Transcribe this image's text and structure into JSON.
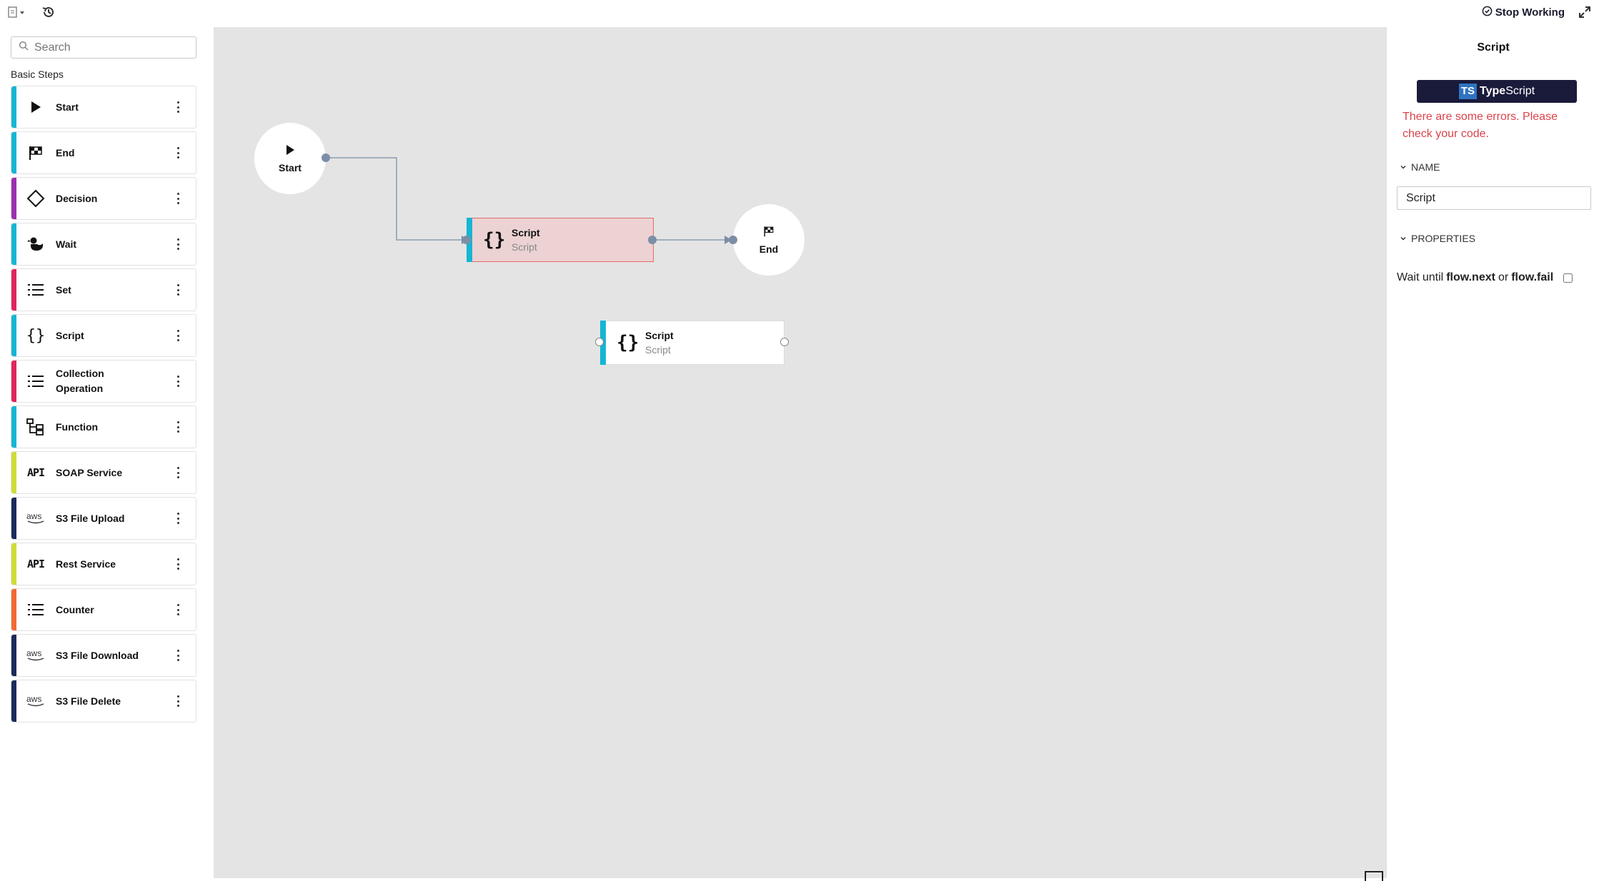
{
  "toolbar": {
    "stop_working_label": "Stop Working"
  },
  "sidebar": {
    "search_placeholder": "Search",
    "section_title": "Basic Steps",
    "steps": [
      {
        "label": "Start",
        "color": "#16b5d4",
        "icon": "play-icon"
      },
      {
        "label": "End",
        "color": "#16b5d4",
        "icon": "checkered-flag-icon"
      },
      {
        "label": "Decision",
        "color": "#9b2fae",
        "icon": "diamond-icon"
      },
      {
        "label": "Wait",
        "color": "#16b5d4",
        "icon": "duck-icon"
      },
      {
        "label": "Set",
        "color": "#e0245e",
        "icon": "list-icon"
      },
      {
        "label": "Script",
        "color": "#16b5d4",
        "icon": "braces-icon"
      },
      {
        "label": "Collection Operation",
        "color": "#e0245e",
        "icon": "list-icon"
      },
      {
        "label": "Function",
        "color": "#16b5d4",
        "icon": "function-tree-icon"
      },
      {
        "label": "SOAP Service",
        "color": "#cddc39",
        "icon": "api-icon"
      },
      {
        "label": "S3 File Upload",
        "color": "#1a2b5a",
        "icon": "aws-icon"
      },
      {
        "label": "Rest Service",
        "color": "#cddc39",
        "icon": "api-icon"
      },
      {
        "label": "Counter",
        "color": "#f06a35",
        "icon": "list-icon"
      },
      {
        "label": "S3 File Download",
        "color": "#1a2b5a",
        "icon": "aws-icon"
      },
      {
        "label": "S3 File Delete",
        "color": "#1a2b5a",
        "icon": "aws-icon"
      }
    ]
  },
  "canvas": {
    "start_node_label": "Start",
    "end_node_label": "End",
    "script_node_1": {
      "title": "Script",
      "subtitle": "Script",
      "state": "error"
    },
    "script_node_2": {
      "title": "Script",
      "subtitle": "Script",
      "state": "normal"
    }
  },
  "panel": {
    "title": "Script",
    "language_badge": "TS",
    "language_name_bold": "Type",
    "language_name_rest": "Script",
    "error_message": "There are some errors. Please check your code.",
    "name_section_label": "NAME",
    "name_value": "Script",
    "properties_section_label": "PROPERTIES",
    "wait_prefix": "Wait until",
    "wait_next": "flow.next",
    "wait_or": "or",
    "wait_fail": "flow.fail",
    "wait_checked": false
  },
  "colors": {
    "accent": "#16b5d4",
    "error_text": "#d9434b",
    "error_node_bg": "#ecd2d2",
    "canvas_bg": "#e4e4e4",
    "ts_button_bg": "#1a1a3a"
  }
}
